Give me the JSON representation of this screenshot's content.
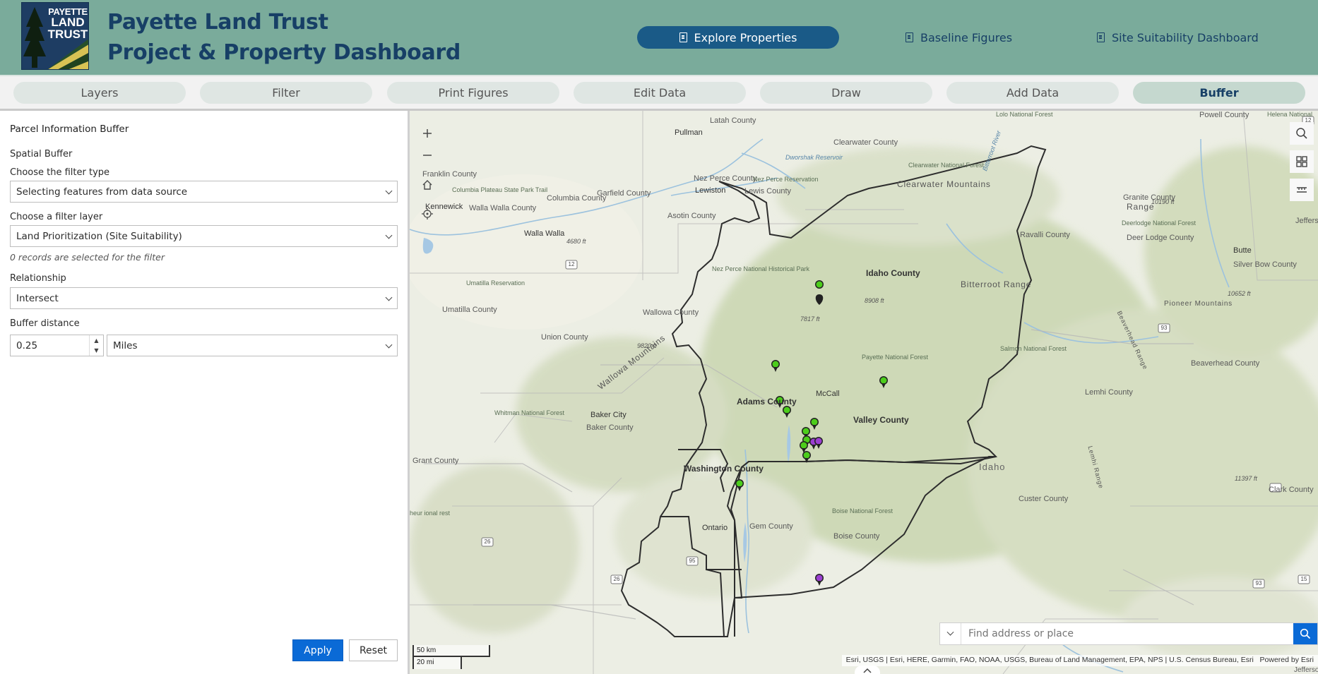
{
  "header": {
    "logo": {
      "line1": "PAYETTE",
      "line2": "LAND",
      "line3": "TRUST"
    },
    "title_line1": "Payette Land Trust",
    "title_line2": "Project & Property Dashboard",
    "nav": [
      {
        "label": "Explore Properties",
        "icon": "document-icon",
        "active": true
      },
      {
        "label": "Baseline Figures",
        "icon": "document-icon",
        "active": false
      },
      {
        "label": "Site Suitability Dashboard",
        "icon": "document-icon",
        "active": false
      }
    ],
    "colors": {
      "header_bg": "#7aab9b",
      "title": "#173f66",
      "active_nav": "#1a5a87"
    }
  },
  "tabs": [
    {
      "label": "Layers",
      "active": false
    },
    {
      "label": "Filter",
      "active": false
    },
    {
      "label": "Print Figures",
      "active": false
    },
    {
      "label": "Edit Data",
      "active": false
    },
    {
      "label": "Draw",
      "active": false
    },
    {
      "label": "Add Data",
      "active": false
    },
    {
      "label": "Buffer",
      "active": true
    }
  ],
  "panel": {
    "title": "Parcel Information Buffer",
    "section": "Spatial Buffer",
    "filter_type_label": "Choose the filter type",
    "filter_type_value": "Selecting features from data source",
    "filter_layer_label": "Choose a filter layer",
    "filter_layer_value": "Land Prioritization (Site Suitability)",
    "records_note": "0 records are selected for the filter",
    "relationship_label": "Relationship",
    "relationship_value": "Intersect",
    "buffer_label": "Buffer distance",
    "buffer_value": "0.25",
    "buffer_units": "Miles",
    "apply_label": "Apply",
    "reset_label": "Reset",
    "colors": {
      "apply_bg": "#0a6ad6"
    }
  },
  "map": {
    "search_placeholder": "Find address or place",
    "scale_km": "50 km",
    "scale_mi": "20 mi",
    "attribution": "Esri, USGS | Esri, HERE, Garmin, FAO, NOAA, USGS, Bureau of Land Management, EPA, NPS | U.S. Census Bureau, Esri",
    "powered_by": "Powered by Esri",
    "labels": {
      "latah": "Latah County",
      "pullman": "Pullman",
      "clearwater_county": "Clearwater County",
      "dworshak": "Dworshak Reservoir",
      "lolo_forest": "Lolo National Forest",
      "helena_forest": "Helena National",
      "powell": "Powell County",
      "franklin": "Franklin County",
      "columbia_trail": "Columbia Plateau State Park Trail",
      "garfield": "Garfield County",
      "lewiston": "Lewiston",
      "clearwater_forest": "Clearwater National Forest",
      "granite": "Granite County",
      "kennewick": "Kennewick",
      "walla_walla_county": "Walla Walla County",
      "columbia_county": "Columbia County",
      "nez_perce_county": "Nez Perce County",
      "nez_perce_res": "Nez Perce Reservation",
      "lewis_county": "Lewis County",
      "clearwater_mtns": "Clearwater Mountains",
      "asotin": "Asotin County",
      "walla_walla": "Walla Walla",
      "elev_4680": "4680 ft",
      "ravalli": "Ravalli County",
      "deerlodge_forest": "Deerlodge National Forest",
      "deer_lodge": "Deer Lodge County",
      "butte": "Butte",
      "silver_bow": "Silver Bow County",
      "jefferson": "Jeffers",
      "nez_perce_park": "Nez Perce National Historical Park",
      "idaho_county": "Idaho County",
      "umatilla_res": "Umatilla Reservation",
      "umatilla_county": "Umatilla County",
      "wallowa_county": "Wallowa County",
      "elev_8908": "8908 ft",
      "bitterroot": "Bitterroot Range",
      "elev_7817": "7817 ft",
      "elev_10652": "10652 ft",
      "pioneer": "Pioneer Mountains",
      "union_county": "Union County",
      "wallowa_mtns": "Wallowa Mountains",
      "elev_9820": "9820 ft",
      "payette_forest": "Payette National Forest",
      "salmon_forest": "Salmon National Forest",
      "beaverhead_county": "Beaverhead County",
      "whitman_forest": "Whitman National Forest",
      "mccall": "McCall",
      "adams_county": "Adams County",
      "lemhi_county": "Lemhi County",
      "baker_city": "Baker City",
      "baker_county": "Baker County",
      "valley_county": "Valley County",
      "grant_county": "Grant County",
      "washington_county": "Washington County",
      "idaho_state": "Idaho",
      "custer_county": "Custer County",
      "clark_county": "Clark County",
      "elev_11397": "11397 ft",
      "elev_10190": "10190 ft",
      "granite_range": "Range",
      "ontario": "Ontario",
      "gem_county": "Gem County",
      "boise_forest": "Boise National Forest",
      "boise_county": "Boise County",
      "malheur": "heur ional rest",
      "route_12a": "12",
      "route_12b": "12",
      "route_93a": "93",
      "route_93b": "93",
      "route_95": "95",
      "route_26a": "26",
      "route_26b": "26",
      "route_15": "15",
      "beaverhead_range": "Beaverhead Range",
      "lemhi_range": "Lemhi Range",
      "bitterroot_river": "Bitterroot River",
      "jefferson_bottom": "Jefferson Cou"
    },
    "colors": {
      "marker_green": "#4ccd1b",
      "marker_purple": "#9b3fd1"
    }
  }
}
